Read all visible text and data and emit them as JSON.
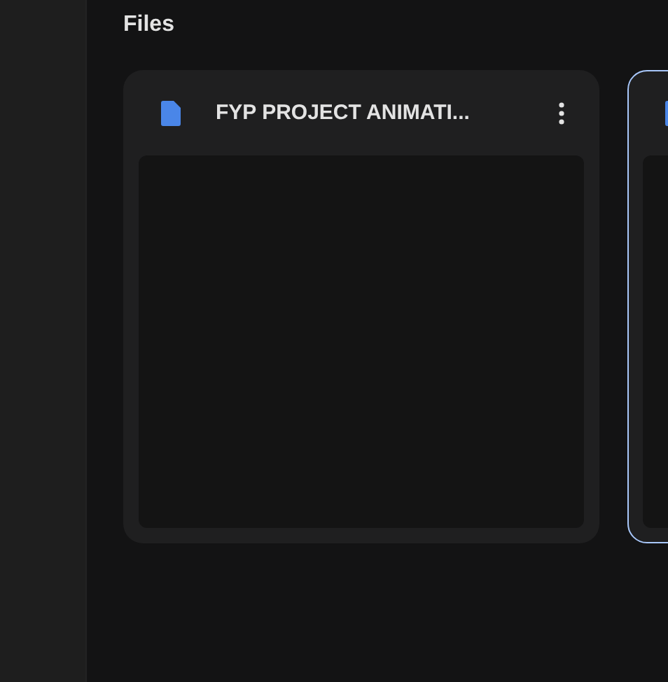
{
  "section_title": "Files",
  "files": [
    {
      "name": "FYP PROJECT ANIMATI...",
      "selected": false
    },
    {
      "selected": true
    }
  ]
}
